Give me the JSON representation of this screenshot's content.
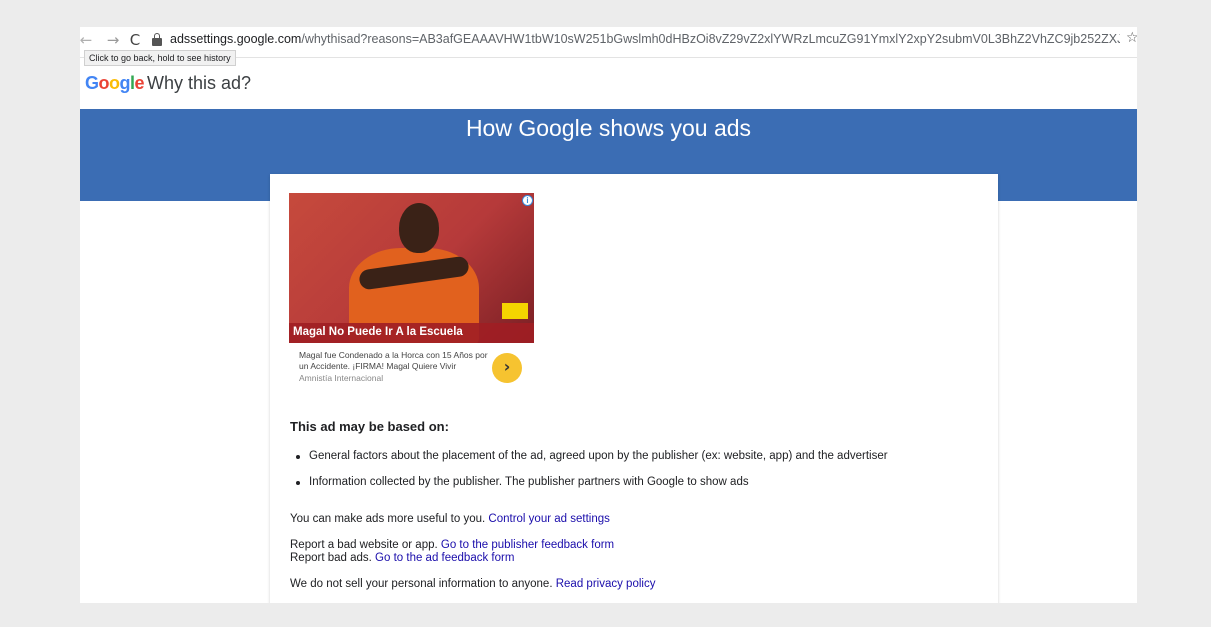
{
  "browser": {
    "url_host": "adssettings.google.com",
    "url_path": "/whythisad?reasons=AB3afGEAAAVHW1tbW10sW251bGwslmh0dHBzOi8vZ29vZ2xlYWRzLmcuZG91YmxlY2xpY2submV0L3BhZ2VhZC9jb252ZXJza...",
    "tooltip": "Click to go back, hold to see history"
  },
  "header": {
    "logo_letters": [
      "G",
      "o",
      "o",
      "g",
      "l",
      "e"
    ],
    "logo_colors": [
      "#4285f4",
      "#ea4335",
      "#fbbc05",
      "#4285f4",
      "#34a853",
      "#ea4335"
    ],
    "title": "Why this ad?"
  },
  "banner": {
    "title": "How Google shows you ads",
    "color": "#3b6db4"
  },
  "ad": {
    "headline": "Magal No Puede Ir A la Escuela",
    "body": "Magal fue Condenado a la Horca con 15 Años por un Accidente. ¡FIRMA! Magal Quiere Vivir",
    "advertiser": "Amnistía Internacional",
    "info_icon": "info-icon",
    "arrow_icon": "chevron-right-icon"
  },
  "reasons": {
    "heading": "This ad may be based on:",
    "items": [
      "General factors about the placement of the ad, agreed upon by the publisher (ex: website, app) and the advertiser",
      "Information collected by the publisher. The publisher partners with Google to show ads"
    ]
  },
  "links": {
    "useful_text": "You can make ads more useful to you.",
    "useful_link": "Control your ad settings",
    "bad_site_text": "Report a bad website or app.",
    "bad_site_link": "Go to the publisher feedback form",
    "bad_ads_text": "Report bad ads.",
    "bad_ads_link": "Go to the ad feedback form",
    "privacy_text": "We do not sell your personal information to anyone.",
    "privacy_link": "Read privacy policy"
  }
}
